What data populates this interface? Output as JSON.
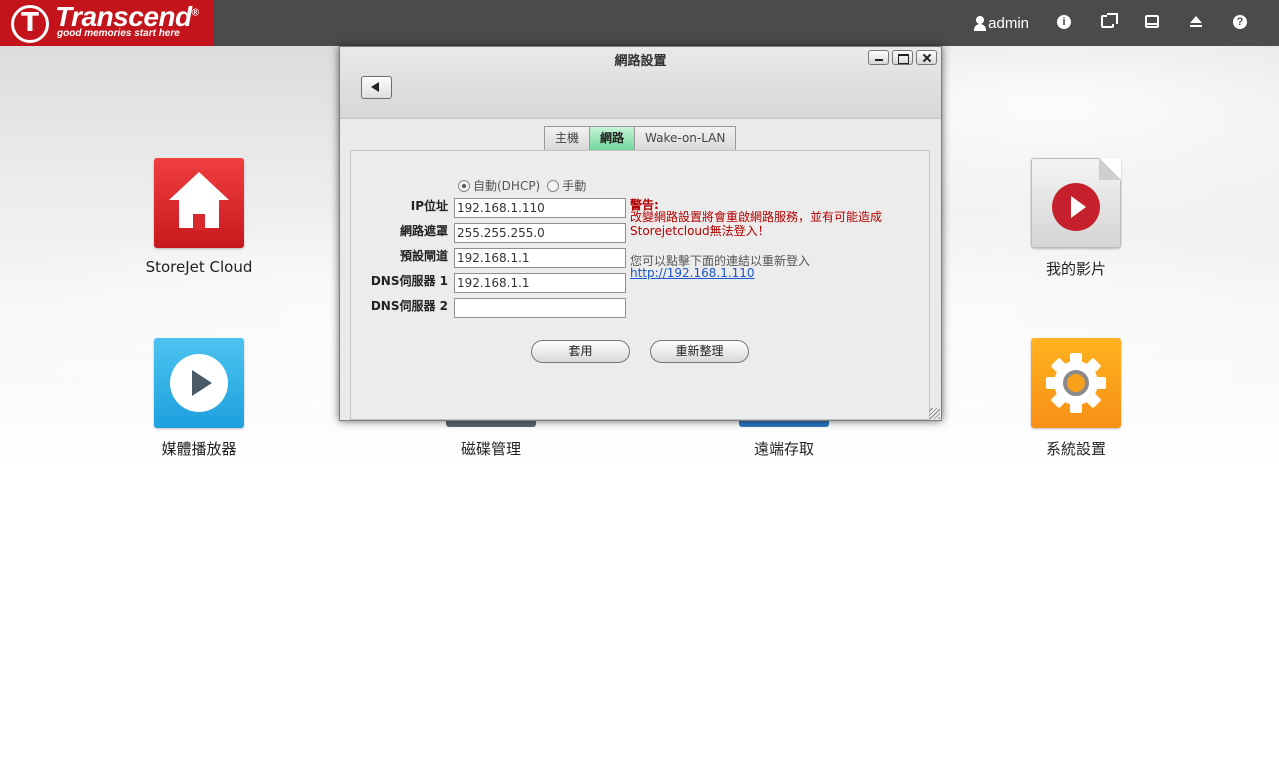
{
  "brand": {
    "logo_mark": "T",
    "name": "Transcend",
    "reg": "®",
    "tagline": "good memories start here",
    "color": "#c3141b"
  },
  "topbar": {
    "user": "admin",
    "icons": [
      "user-icon",
      "info-icon",
      "external-link-icon",
      "disk-icon",
      "eject-icon",
      "help-icon"
    ],
    "info_glyph": "i",
    "help_glyph": "?"
  },
  "apps": [
    {
      "label": "StoreJet Cloud",
      "icon": "home-icon"
    },
    {
      "label": "我的影片",
      "icon": "video-play-icon"
    },
    {
      "label": "媒體播放器",
      "icon": "media-player-icon"
    },
    {
      "label": "磁碟管理",
      "icon": "disk-management-icon"
    },
    {
      "label": "遠端存取",
      "icon": "remote-access-icon"
    },
    {
      "label": "系統設置",
      "icon": "settings-gear-icon"
    }
  ],
  "dialog": {
    "title": "網路設置",
    "tabs": [
      {
        "label": "主機",
        "active": false
      },
      {
        "label": "網路",
        "active": true
      },
      {
        "label": "Wake-on-LAN",
        "active": false
      }
    ],
    "mode": {
      "auto_label": "自動(DHCP)",
      "manual_label": "手動",
      "selected": "auto"
    },
    "fields": {
      "ip_label": "IP位址",
      "ip_value": "192.168.1.110",
      "mask_label": "網路遮罩",
      "mask_value": "255.255.255.0",
      "gateway_label": "預設閘道",
      "gateway_value": "192.168.1.1",
      "dns1_label": "DNS伺服器 1",
      "dns1_value": "192.168.1.1",
      "dns2_label": "DNS伺服器 2",
      "dns2_value": ""
    },
    "warning_title": "警告:",
    "warning_text": "改變網路設置將會重啟網路服務，並有可能造成Storejetcloud無法登入！",
    "info_text": "您可以點擊下面的連結以重新登入",
    "info_link": "http://192.168.1.110",
    "apply_label": "套用",
    "refresh_label": "重新整理"
  },
  "colors": {
    "topbar": "#4b4b4b",
    "active_tab": "#72d79b",
    "warning": "#b50000",
    "link": "#1a55c9"
  }
}
